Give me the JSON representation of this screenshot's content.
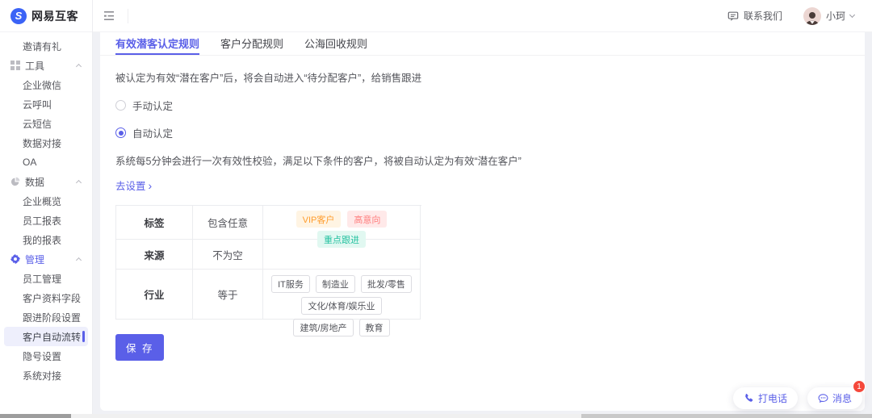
{
  "brand": {
    "name": "网易互客",
    "logo_letter": "S"
  },
  "colors": {
    "accent": "#5a5fe8",
    "logo_blue": "#3b63f6",
    "tag_orange_text": "#ff9d2e",
    "tag_red_text": "#ff7d7d",
    "tag_teal_text": "#27c2a1",
    "badge_red": "#f5483b"
  },
  "topbar": {
    "contact_label": "联系我们",
    "user_name": "小珂"
  },
  "sidebar": {
    "invite_label": "邀请有礼",
    "groups": [
      {
        "label": "工具",
        "items": [
          {
            "label": "企业微信"
          },
          {
            "label": "云呼叫"
          },
          {
            "label": "云短信"
          },
          {
            "label": "数据对接"
          },
          {
            "label": "OA"
          }
        ]
      },
      {
        "label": "数据",
        "items": [
          {
            "label": "企业概览"
          },
          {
            "label": "员工报表"
          },
          {
            "label": "我的报表"
          }
        ]
      },
      {
        "label": "管理",
        "items": [
          {
            "label": "员工管理"
          },
          {
            "label": "客户资料字段"
          },
          {
            "label": "跟进阶段设置"
          },
          {
            "label": "客户自动流转",
            "active": true
          },
          {
            "label": "隐号设置"
          },
          {
            "label": "系统对接"
          }
        ]
      }
    ]
  },
  "tabs": [
    {
      "label": "有效潜客认定规则",
      "active": true
    },
    {
      "label": "客户分配规则",
      "active": false
    },
    {
      "label": "公海回收规则",
      "active": false
    }
  ],
  "panel": {
    "intro": "被认定为有效“潜在客户”后，将会自动进入“待分配客户”，给销售跟进",
    "manual_radio_label": "手动认定",
    "auto_radio_label": "自动认定",
    "selected_mode": "自动认定",
    "auto_description": "系统每5分钟会进行一次有效性校验，满足以下条件的客户，将被自动认定为有效“潜在客户”",
    "settings_link": "去设置",
    "settings_link_arrow": "›",
    "table": {
      "rows": [
        {
          "field": "标签",
          "condition": "包含任意"
        },
        {
          "field": "来源",
          "condition": "不为空"
        },
        {
          "field": "行业",
          "condition": "等于"
        }
      ],
      "label_tags": [
        {
          "text": "VIP客户"
        },
        {
          "text": "高意向"
        },
        {
          "text": "重点跟进"
        }
      ],
      "industry_tags": [
        {
          "text": "IT服务"
        },
        {
          "text": "制造业"
        },
        {
          "text": "批发/零售"
        },
        {
          "text": "文化/体育/娱乐业"
        },
        {
          "text": "建筑/房地产"
        },
        {
          "text": "教育"
        }
      ]
    },
    "save_label": "保 存"
  },
  "floating": {
    "call_label": "打电话",
    "message_label": "消息",
    "message_badge": "1"
  }
}
